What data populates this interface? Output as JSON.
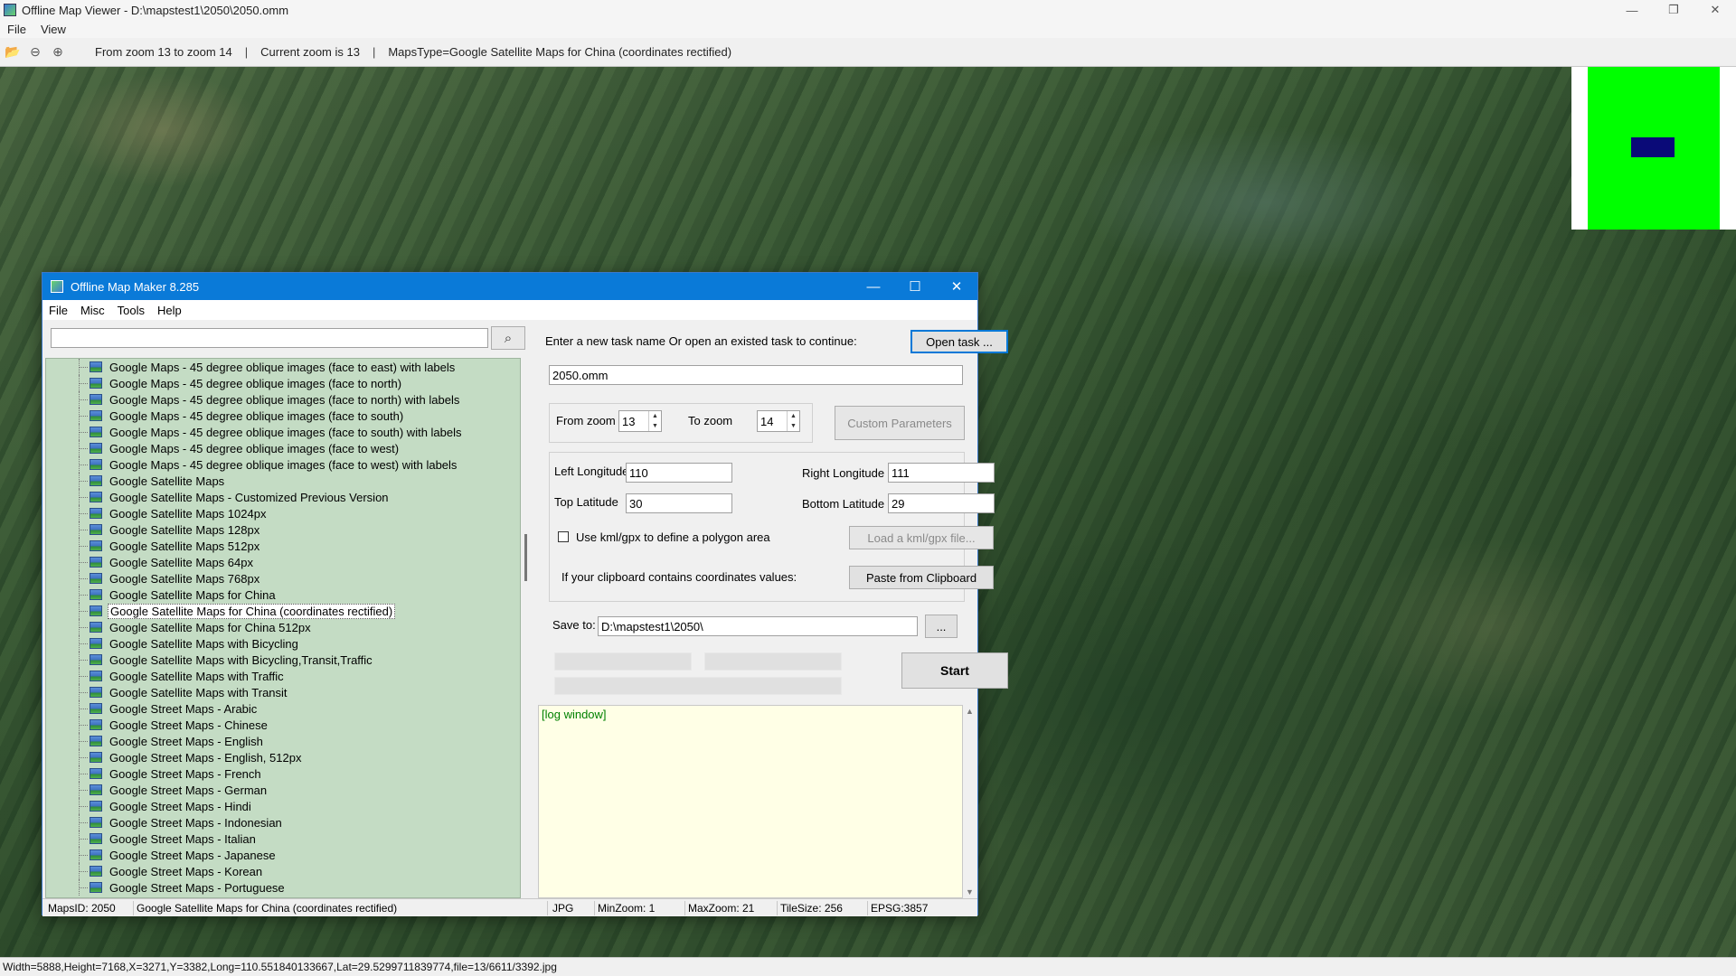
{
  "viewer": {
    "title": "Offline Map Viewer - D:\\mapstest1\\2050\\2050.omm",
    "menu": [
      "File",
      "View"
    ],
    "toolbar": {
      "zoom_range": "From zoom 13 to zoom 14",
      "current_zoom": "Current zoom is 13",
      "maps_type": "MapsType=Google Satellite Maps for China (coordinates rectified)",
      "separator": "|"
    },
    "status": "Width=5888,Height=7168,X=3271,Y=3382,Long=110.551840133667,Lat=29.5299711839774,file=13/6611/3392.jpg"
  },
  "dialog": {
    "title": "Offline Map Maker 8.285",
    "menu": [
      "File",
      "Misc",
      "Tools",
      "Help"
    ],
    "search": {
      "value": "",
      "placeholder": ""
    },
    "tree_items": [
      "Google Maps - 45 degree oblique images (face to east) with labels",
      "Google Maps - 45 degree oblique images (face to north)",
      "Google Maps - 45 degree oblique images (face to north) with labels",
      "Google Maps - 45 degree oblique images (face to south)",
      "Google Maps - 45 degree oblique images (face to south) with labels",
      "Google Maps - 45 degree oblique images (face to west)",
      "Google Maps - 45 degree oblique images (face to west) with labels",
      "Google Satellite Maps",
      "Google Satellite Maps - Customized Previous Version",
      "Google Satellite Maps 1024px",
      "Google Satellite Maps 128px",
      "Google Satellite Maps 512px",
      "Google Satellite Maps 64px",
      "Google Satellite Maps 768px",
      "Google Satellite Maps for China",
      "Google Satellite Maps for China (coordinates rectified)",
      "Google Satellite Maps for China 512px",
      "Google Satellite Maps with Bicycling",
      "Google Satellite Maps with Bicycling,Transit,Traffic",
      "Google Satellite Maps with Traffic",
      "Google Satellite Maps with Transit",
      "Google Street Maps - Arabic",
      "Google Street Maps - Chinese",
      "Google Street Maps - English",
      "Google Street Maps - English, 512px",
      "Google Street Maps - French",
      "Google Street Maps - German",
      "Google Street Maps - Hindi",
      "Google Street Maps - Indonesian",
      "Google Street Maps - Italian",
      "Google Street Maps - Japanese",
      "Google Street Maps - Korean",
      "Google Street Maps - Portuguese"
    ],
    "selected_index": 15,
    "task_prompt": "Enter a new task name Or open an existed task to continue:",
    "open_task_label": "Open task ...",
    "task_name": "2050.omm",
    "from_zoom_label": "From zoom",
    "from_zoom": "13",
    "to_zoom_label": "To zoom",
    "to_zoom": "14",
    "custom_params_label": "Custom Parameters",
    "left_lon_label": "Left Longitude",
    "left_lon": "110",
    "right_lon_label": "Right Longitude",
    "right_lon": "111",
    "top_lat_label": "Top Latitude",
    "top_lat": "30",
    "bottom_lat_label": "Bottom Latitude",
    "bottom_lat": "29",
    "kml_label": "Use kml/gpx to define a polygon area",
    "load_kml_label": "Load a kml/gpx file...",
    "clipboard_label": "If your clipboard contains coordinates values:",
    "paste_label": "Paste from Clipboard",
    "save_to_label": "Save to:",
    "save_to": "D:\\mapstest1\\2050\\",
    "browse_label": "...",
    "start_label": "Start",
    "log_text": "[log window]",
    "status": {
      "maps_id": "MapsID: 2050",
      "maps_name": "Google Satellite Maps for China (coordinates rectified)",
      "format": "JPG",
      "min_zoom": "MinZoom: 1",
      "max_zoom": "MaxZoom: 21",
      "tile_size": "TileSize: 256",
      "epsg": "EPSG:3857"
    }
  }
}
